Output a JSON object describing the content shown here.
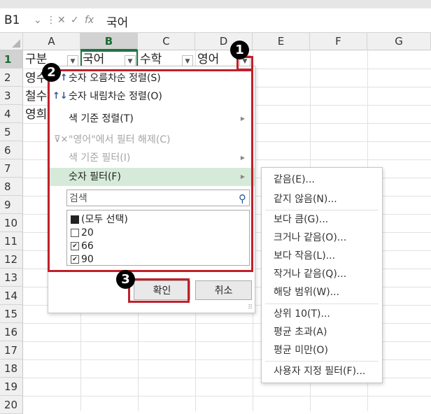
{
  "formula_bar": {
    "name_box": "B1",
    "fx": "fx",
    "formula": "국어"
  },
  "columns": [
    "A",
    "B",
    "C",
    "D",
    "E",
    "F",
    "G"
  ],
  "rows": [
    "1",
    "2",
    "3",
    "4",
    "5",
    "6",
    "7",
    "8",
    "9",
    "10",
    "11",
    "12",
    "13",
    "14",
    "15",
    "16",
    "17",
    "18",
    "19",
    "20"
  ],
  "cells": {
    "a1": "구분",
    "b1": "국어",
    "c1": "수학",
    "d1": "영어",
    "a2": "영수",
    "a3": "철수",
    "a4": "영희"
  },
  "menu": {
    "sort_asc": "숫자 오름차순 정렬(S)",
    "sort_desc": "숫자 내림차순 정렬(O)",
    "sort_color": "색 기준 정렬(T)",
    "clear_filter": "\"영어\"에서 필터 해제(C)",
    "filter_color": "색 기준 필터(I)",
    "number_filter": "숫자 필터(F)",
    "search_placeholder": "검색",
    "list": [
      "(모두 선택)",
      "20",
      "66",
      "90"
    ],
    "ok": "확인",
    "cancel": "취소"
  },
  "submenu": [
    "같음(E)...",
    "같지 않음(N)...",
    "보다 큼(G)...",
    "크거나 같음(O)...",
    "보다 작음(L)...",
    "작거나 같음(Q)...",
    "해당 범위(W)...",
    "상위 10(T)...",
    "평균 초과(A)",
    "평균 미만(O)",
    "사용자 지정 필터(F)..."
  ],
  "badges": [
    "1",
    "2",
    "3"
  ],
  "colors": {
    "accent_green": "#217346",
    "highlight": "#d6ead9",
    "callout_red": "#c0202a"
  }
}
